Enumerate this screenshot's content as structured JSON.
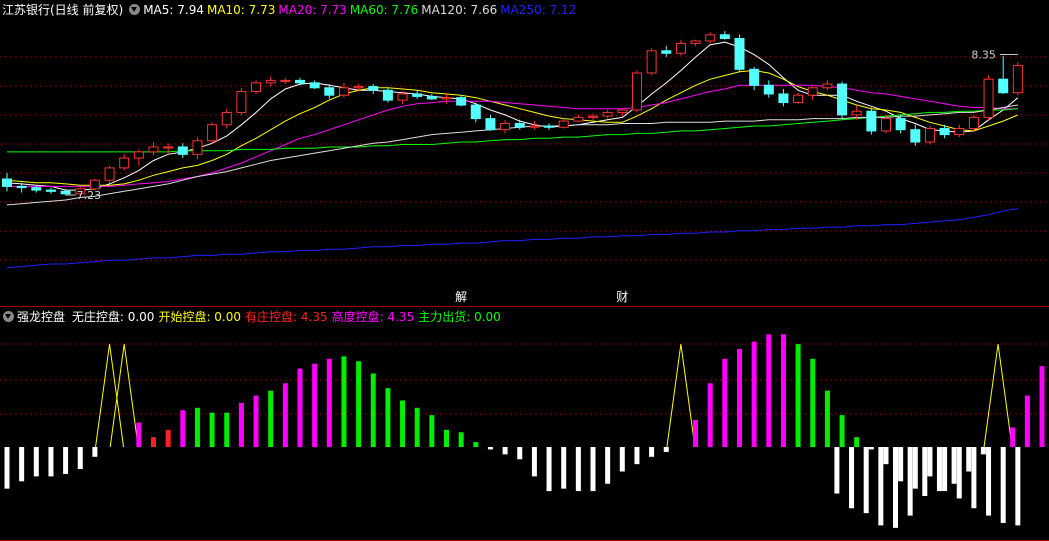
{
  "main_panel": {
    "title": "江苏银行(日线 前复权)",
    "indicators": [
      {
        "label": "MA5: 7.94",
        "color": "#ffffff"
      },
      {
        "label": "MA10: 7.73",
        "color": "#ffff00"
      },
      {
        "label": "MA20: 7.73",
        "color": "#ff00ff"
      },
      {
        "label": "MA60: 7.76",
        "color": "#00ff00"
      },
      {
        "label": "MA120: 7.66",
        "color": "#dddddd"
      },
      {
        "label": "MA250: 7.12",
        "color": "#2020ff"
      }
    ],
    "high_label": "8.35",
    "low_label": "7.23",
    "event_markers": [
      "解",
      "财"
    ]
  },
  "sub_panel": {
    "name": "强龙控盘",
    "indicators": [
      {
        "label": "无庄控盘:",
        "value": "0.00",
        "color": "#ffffff"
      },
      {
        "label": "开始控盘:",
        "value": "0.00",
        "color": "#ffff00"
      },
      {
        "label": "有庄控盘:",
        "value": "4.35",
        "color": "#ff2020"
      },
      {
        "label": "高度控盘:",
        "value": "4.35",
        "color": "#ff00ff"
      },
      {
        "label": "主力出货:",
        "value": "0.00",
        "color": "#00ff00"
      }
    ]
  },
  "colors": {
    "up": "#ff3232",
    "down": "#54ffff",
    "grid": "#8b0000",
    "divider": "#a00000",
    "background": "#000000"
  },
  "chart_data": [
    {
      "type": "candlestick",
      "title": "江苏银行(日线 前复权)",
      "candles_ohlc": [
        [
          7.36,
          7.41,
          7.26,
          7.3
        ],
        [
          7.3,
          7.33,
          7.25,
          7.29
        ],
        [
          7.29,
          7.3,
          7.25,
          7.27
        ],
        [
          7.27,
          7.29,
          7.24,
          7.26
        ],
        [
          7.26,
          7.28,
          7.23,
          7.24
        ],
        [
          7.24,
          7.3,
          7.23,
          7.28
        ],
        [
          7.28,
          7.36,
          7.27,
          7.35
        ],
        [
          7.35,
          7.47,
          7.33,
          7.45
        ],
        [
          7.45,
          7.56,
          7.43,
          7.53
        ],
        [
          7.53,
          7.6,
          7.47,
          7.58
        ],
        [
          7.58,
          7.66,
          7.55,
          7.62
        ],
        [
          7.62,
          7.65,
          7.56,
          7.62
        ],
        [
          7.62,
          7.65,
          7.53,
          7.56
        ],
        [
          7.56,
          7.7,
          7.52,
          7.67
        ],
        [
          7.67,
          7.82,
          7.65,
          7.8
        ],
        [
          7.8,
          7.93,
          7.77,
          7.9
        ],
        [
          7.9,
          8.1,
          7.88,
          8.07
        ],
        [
          8.07,
          8.16,
          8.05,
          8.14
        ],
        [
          8.14,
          8.19,
          8.11,
          8.16
        ],
        [
          8.16,
          8.18,
          8.13,
          8.16
        ],
        [
          8.16,
          8.18,
          8.12,
          8.14
        ],
        [
          8.14,
          8.16,
          8.09,
          8.1
        ],
        [
          8.1,
          8.13,
          8.01,
          8.04
        ],
        [
          8.04,
          8.14,
          8.02,
          8.1
        ],
        [
          8.1,
          8.13,
          8.07,
          8.11
        ],
        [
          8.11,
          8.13,
          8.05,
          8.08
        ],
        [
          8.08,
          8.1,
          7.98,
          8.0
        ],
        [
          8.0,
          8.07,
          7.97,
          8.05
        ],
        [
          8.05,
          8.08,
          8.01,
          8.03
        ],
        [
          8.03,
          8.05,
          8.0,
          8.01
        ],
        [
          8.01,
          8.05,
          7.97,
          8.02
        ],
        [
          8.02,
          8.04,
          7.95,
          7.96
        ],
        [
          7.96,
          7.98,
          7.82,
          7.85
        ],
        [
          7.85,
          7.88,
          7.75,
          7.76
        ],
        [
          7.76,
          7.84,
          7.73,
          7.81
        ],
        [
          7.81,
          7.84,
          7.76,
          7.78
        ],
        [
          7.78,
          7.83,
          7.76,
          7.79
        ],
        [
          7.79,
          7.81,
          7.76,
          7.78
        ],
        [
          7.78,
          7.85,
          7.77,
          7.83
        ],
        [
          7.83,
          7.88,
          7.82,
          7.86
        ],
        [
          7.86,
          7.89,
          7.84,
          7.87
        ],
        [
          7.87,
          7.92,
          7.85,
          7.9
        ],
        [
          7.9,
          7.93,
          7.87,
          7.92
        ],
        [
          7.92,
          8.24,
          7.9,
          8.22
        ],
        [
          8.22,
          8.42,
          8.2,
          8.4
        ],
        [
          8.4,
          8.44,
          8.35,
          8.38
        ],
        [
          8.38,
          8.49,
          8.36,
          8.46
        ],
        [
          8.46,
          8.49,
          8.44,
          8.48
        ],
        [
          8.48,
          8.55,
          8.46,
          8.53
        ],
        [
          8.53,
          8.56,
          8.49,
          8.5
        ],
        [
          8.5,
          8.53,
          8.23,
          8.25
        ],
        [
          8.25,
          8.27,
          8.08,
          8.12
        ],
        [
          8.12,
          8.16,
          8.02,
          8.05
        ],
        [
          8.05,
          8.09,
          7.95,
          7.98
        ],
        [
          7.98,
          8.06,
          7.97,
          8.04
        ],
        [
          8.04,
          8.12,
          8.0,
          8.1
        ],
        [
          8.1,
          8.16,
          8.08,
          8.13
        ],
        [
          8.13,
          8.15,
          7.85,
          7.88
        ],
        [
          7.88,
          7.96,
          7.84,
          7.91
        ],
        [
          7.91,
          7.94,
          7.72,
          7.75
        ],
        [
          7.75,
          7.88,
          7.73,
          7.85
        ],
        [
          7.85,
          7.88,
          7.73,
          7.76
        ],
        [
          7.76,
          7.8,
          7.63,
          7.66
        ],
        [
          7.66,
          7.79,
          7.64,
          7.77
        ],
        [
          7.77,
          7.8,
          7.69,
          7.72
        ],
        [
          7.72,
          7.8,
          7.7,
          7.77
        ],
        [
          7.77,
          7.88,
          7.75,
          7.86
        ],
        [
          7.86,
          8.2,
          7.84,
          8.17
        ],
        [
          8.17,
          8.36,
          8.05,
          8.06
        ],
        [
          8.06,
          8.31,
          8.04,
          8.28
        ]
      ],
      "ma_series": [
        {
          "name": "MA5",
          "color": "#ffffff",
          "values": [
            7.33,
            7.32,
            7.31,
            7.3,
            7.27,
            7.27,
            7.28,
            7.32,
            7.37,
            7.43,
            7.51,
            7.56,
            7.58,
            7.61,
            7.65,
            7.71,
            7.8,
            7.9,
            8.01,
            8.09,
            8.13,
            8.14,
            8.12,
            8.1,
            8.08,
            8.08,
            8.07,
            8.06,
            8.05,
            8.03,
            8.02,
            8.01,
            7.97,
            7.92,
            7.88,
            7.83,
            7.8,
            7.78,
            7.79,
            7.8,
            7.82,
            7.84,
            7.86,
            7.95,
            8.05,
            8.14,
            8.24,
            8.35,
            8.45,
            8.47,
            8.43,
            8.37,
            8.29,
            8.18,
            8.08,
            8.04,
            8.04,
            8.04,
            7.99,
            7.95,
            7.91,
            7.85,
            7.81,
            7.76,
            7.75,
            7.74,
            7.75,
            7.84,
            7.92,
            8.02
          ]
        },
        {
          "name": "MA10",
          "color": "#ffff00",
          "values": [
            7.35,
            7.34,
            7.33,
            7.33,
            7.32,
            7.31,
            7.31,
            7.31,
            7.32,
            7.35,
            7.39,
            7.42,
            7.45,
            7.47,
            7.51,
            7.56,
            7.63,
            7.69,
            7.76,
            7.83,
            7.89,
            7.94,
            8.0,
            8.05,
            8.08,
            8.1,
            8.1,
            8.09,
            8.08,
            8.06,
            8.05,
            8.04,
            8.02,
            7.99,
            7.96,
            7.93,
            7.9,
            7.87,
            7.85,
            7.84,
            7.83,
            7.82,
            7.82,
            7.87,
            7.93,
            8.0,
            8.06,
            8.12,
            8.17,
            8.2,
            8.23,
            8.24,
            8.22,
            8.17,
            8.11,
            8.07,
            8.04,
            8.0,
            7.96,
            7.93,
            7.92,
            7.9,
            7.86,
            7.82,
            7.79,
            7.76,
            7.75,
            7.79,
            7.83,
            7.88
          ]
        },
        {
          "name": "MA20",
          "color": "#ff00ff",
          "values": [
            7.3,
            7.3,
            7.3,
            7.3,
            7.3,
            7.3,
            7.3,
            7.3,
            7.31,
            7.32,
            7.33,
            7.34,
            7.36,
            7.38,
            7.41,
            7.45,
            7.49,
            7.54,
            7.59,
            7.64,
            7.69,
            7.72,
            7.76,
            7.8,
            7.84,
            7.88,
            7.92,
            7.95,
            7.97,
            7.98,
            7.99,
            7.99,
            7.99,
            7.99,
            7.98,
            7.97,
            7.96,
            7.95,
            7.94,
            7.93,
            7.93,
            7.93,
            7.93,
            7.94,
            7.96,
            7.98,
            8.01,
            8.04,
            8.07,
            8.09,
            8.12,
            8.12,
            8.12,
            8.12,
            8.12,
            8.12,
            8.11,
            8.1,
            8.08,
            8.06,
            8.05,
            8.03,
            8.01,
            7.99,
            7.97,
            7.95,
            7.94,
            7.94,
            7.93,
            7.93
          ]
        },
        {
          "name": "MA60",
          "color": "#00ff00",
          "values": [
            7.58,
            7.58,
            7.58,
            7.58,
            7.58,
            7.58,
            7.58,
            7.58,
            7.58,
            7.58,
            7.58,
            7.58,
            7.59,
            7.59,
            7.59,
            7.59,
            7.6,
            7.6,
            7.6,
            7.61,
            7.61,
            7.61,
            7.62,
            7.62,
            7.62,
            7.63,
            7.63,
            7.64,
            7.64,
            7.64,
            7.65,
            7.66,
            7.66,
            7.67,
            7.68,
            7.68,
            7.69,
            7.69,
            7.7,
            7.7,
            7.71,
            7.72,
            7.72,
            7.73,
            7.73,
            7.74,
            7.75,
            7.75,
            7.76,
            7.77,
            7.78,
            7.79,
            7.79,
            7.8,
            7.81,
            7.82,
            7.83,
            7.84,
            7.85,
            7.86,
            7.87,
            7.88,
            7.89,
            7.9,
            7.9,
            7.91,
            7.91,
            7.92,
            7.92,
            7.93
          ]
        },
        {
          "name": "MA120",
          "color": "#dddddd",
          "values": [
            7.15,
            7.16,
            7.17,
            7.18,
            7.19,
            7.21,
            7.22,
            7.24,
            7.26,
            7.28,
            7.3,
            7.32,
            7.35,
            7.38,
            7.4,
            7.42,
            7.45,
            7.48,
            7.51,
            7.53,
            7.55,
            7.57,
            7.59,
            7.61,
            7.63,
            7.65,
            7.66,
            7.68,
            7.7,
            7.72,
            7.73,
            7.74,
            7.75,
            7.76,
            7.77,
            7.78,
            7.79,
            7.79,
            7.79,
            7.8,
            7.8,
            7.8,
            7.81,
            7.81,
            7.81,
            7.82,
            7.82,
            7.82,
            7.82,
            7.83,
            7.83,
            7.83,
            7.84,
            7.84,
            7.84,
            7.85,
            7.85,
            7.85,
            7.86,
            7.86,
            7.86,
            7.87,
            7.87,
            7.88,
            7.89,
            7.9,
            7.9,
            7.92,
            7.94,
            7.96
          ]
        },
        {
          "name": "MA250",
          "color": "#2020ff",
          "values": [
            6.64,
            6.65,
            6.66,
            6.67,
            6.67,
            6.68,
            6.69,
            6.7,
            6.7,
            6.71,
            6.72,
            6.72,
            6.73,
            6.74,
            6.74,
            6.75,
            6.75,
            6.76,
            6.77,
            6.77,
            6.78,
            6.78,
            6.79,
            6.79,
            6.8,
            6.81,
            6.81,
            6.82,
            6.82,
            6.83,
            6.83,
            6.84,
            6.84,
            6.85,
            6.86,
            6.86,
            6.87,
            6.87,
            6.88,
            6.88,
            6.89,
            6.89,
            6.9,
            6.9,
            6.91,
            6.91,
            6.92,
            6.92,
            6.93,
            6.93,
            6.94,
            6.94,
            6.95,
            6.95,
            6.96,
            6.96,
            6.97,
            6.97,
            6.98,
            6.98,
            6.99,
            6.99,
            7.0,
            7.01,
            7.02,
            7.03,
            7.05,
            7.07,
            7.1,
            7.12
          ]
        }
      ],
      "ylim": [
        6.5,
        8.65
      ],
      "grid": true
    },
    {
      "type": "bar",
      "title": "强龙控盘",
      "bar_values": [
        -1.7,
        -1.4,
        -1.2,
        -1.2,
        -1.1,
        -0.9,
        -0.4,
        -0.2,
        0.4,
        1.0,
        0.4,
        0.7,
        1.5,
        1.6,
        1.4,
        1.4,
        1.8,
        2.1,
        2.3,
        2.6,
        3.2,
        3.4,
        3.6,
        3.7,
        3.5,
        3.0,
        2.4,
        1.9,
        1.6,
        1.3,
        0.7,
        0.6,
        0.2,
        -0.1,
        -0.3,
        -0.5,
        -1.2,
        -1.8,
        -1.7,
        -1.8,
        -1.8,
        -1.5,
        -1.0,
        -0.7,
        -0.4,
        -0.2,
        0.2,
        1.1,
        2.6,
        3.6,
        4.0,
        4.3,
        4.6,
        4.6,
        4.2,
        3.6,
        2.3,
        1.3,
        0.4,
        -0.1,
        -0.7,
        -1.4,
        -1.7,
        -1.2,
        -1.8,
        -2.1,
        -2.5,
        -2.8,
        -3.1,
        -3.2
      ],
      "bar_colors": [
        "w",
        "w",
        "w",
        "w",
        "w",
        "w",
        "w",
        "y",
        "y",
        "m",
        "r",
        "r",
        "m",
        "g",
        "g",
        "g",
        "m",
        "m",
        "g",
        "m",
        "m",
        "m",
        "m",
        "g",
        "g",
        "g",
        "g",
        "g",
        "g",
        "g",
        "g",
        "g",
        "g",
        "w",
        "w",
        "w",
        "w",
        "w",
        "w",
        "w",
        "w",
        "w",
        "w",
        "w",
        "w",
        "w",
        "y",
        "m",
        "m",
        "m",
        "m",
        "m",
        "m",
        "m",
        "g",
        "g",
        "g",
        "g",
        "g",
        "w",
        "w",
        "w",
        "w",
        "w",
        "w",
        "w",
        "w",
        "w",
        "w",
        "w"
      ],
      "sub_bar_values": [
        -1.9,
        -2.5,
        -2.7,
        -3.2,
        -3.3,
        -2.8,
        -2.0,
        -1.8,
        -1.5,
        -1.0,
        -0.3,
        0.2,
        0.8,
        2.1,
        3.3
      ],
      "sub_bar_colors": [
        "w",
        "w",
        "w",
        "w",
        "w",
        "w",
        "w",
        "w",
        "w",
        "w",
        "w",
        "y",
        "m",
        "m",
        "m"
      ],
      "ylim": [
        -5.0,
        6.0
      ]
    }
  ]
}
